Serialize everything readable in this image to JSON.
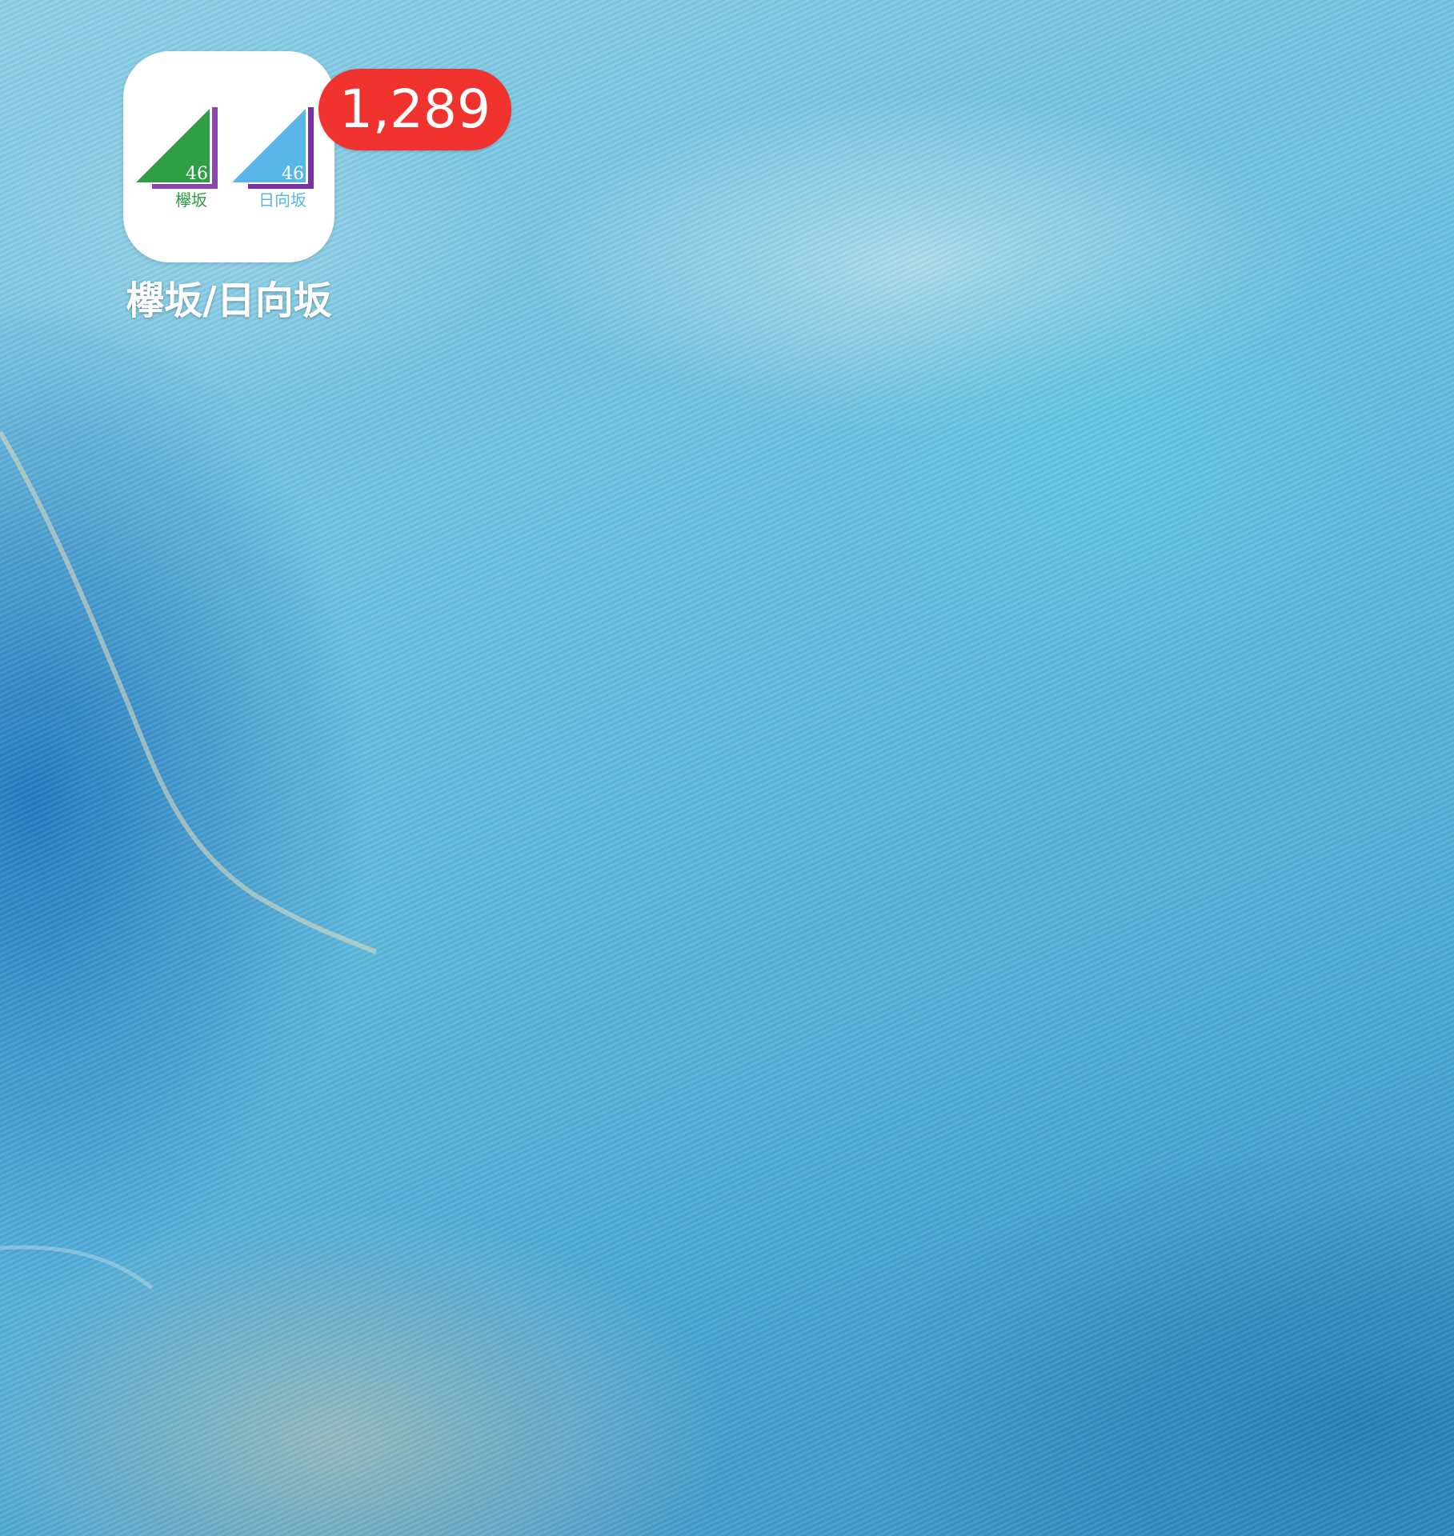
{
  "home_screen": {
    "wallpaper": "ocean-wallpaper",
    "apps": [
      {
        "label": "欅坂/日向坂",
        "badge": "1,289",
        "icon_name": "keyakizaka-hinatazaka-app-icon",
        "logos": [
          {
            "number": "46",
            "text": "欅坂",
            "triangle_color": "#2f9e44",
            "text_color": "#2f9e44",
            "accent_color": "#8e44ad"
          },
          {
            "number": "46",
            "text": "日向坂",
            "triangle_color": "#58b7e6",
            "text_color": "#58b7e6",
            "accent_color": "#7b2fa6"
          }
        ]
      }
    ]
  },
  "colors": {
    "badge": "#f0332f",
    "label": "#ffffff"
  }
}
